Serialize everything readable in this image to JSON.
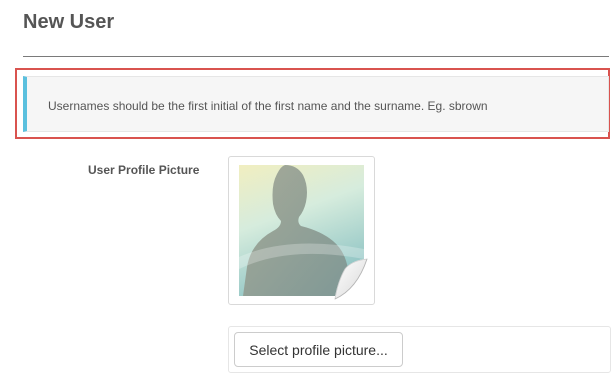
{
  "page": {
    "title": "New User"
  },
  "notice": {
    "text": "Usernames should be the first initial of the first name and the surname. Eg. sbrown"
  },
  "profile_picture": {
    "label": "User Profile Picture",
    "placeholder_icon": "default-avatar-silhouette-icon"
  },
  "upload": {
    "button_label": "Select profile picture..."
  },
  "colors": {
    "callout_accent": "#5bc0de",
    "highlight_outline": "#d9534f",
    "text": "#555555"
  }
}
